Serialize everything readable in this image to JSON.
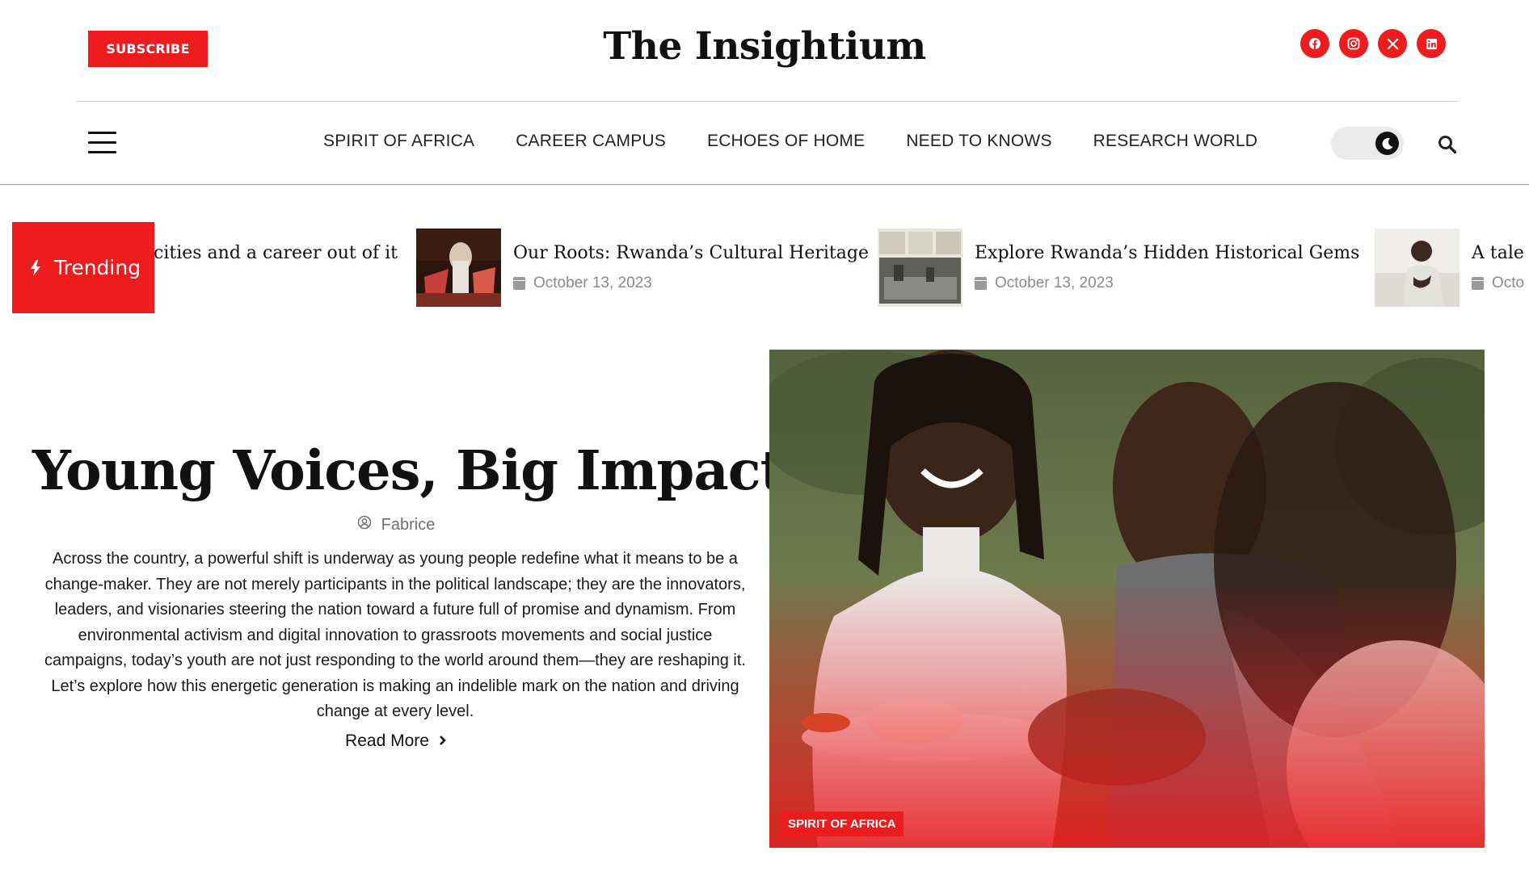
{
  "header": {
    "subscribe_label": "SUBSCRIBE",
    "site_title": "The Insightium",
    "socials": [
      "facebook-icon",
      "instagram-icon",
      "x-icon",
      "linkedin-icon"
    ]
  },
  "nav": {
    "items": [
      "SPIRIT OF AFRICA",
      "CAREER CAMPUS",
      "ECHOES OF HOME",
      "NEED TO KNOWS",
      "RESEARCH WORLD"
    ]
  },
  "trending": {
    "label": "Trending",
    "items": [
      {
        "title": "cities and a career out of it",
        "date": ""
      },
      {
        "title": "Our Roots: Rwanda’s Cultural Heritage",
        "date": "October 13, 2023"
      },
      {
        "title": "Explore Rwanda’s Hidden Historical Gems",
        "date": "October 13, 2023"
      },
      {
        "title": "A tale",
        "date": "Octo"
      }
    ]
  },
  "hero": {
    "title": "Young Voices, Big Impact",
    "author": "Fabrice",
    "excerpt": "Across the country, a powerful shift is underway as young people redefine what it means to be a change-maker. They are not merely participants in the political landscape; they are the innovators, leaders, and visionaries steering the nation toward a future full of promise and dynamism. From environmental activism and digital innovation to grassroots movements and social justice campaigns, today’s youth are not just responding to the world around them—they are reshaping it. Let’s explore how this energetic generation is making an indelible mark on the nation and driving change at every level.",
    "read_more": "Read More",
    "tag": "SPIRIT OF AFRICA"
  },
  "colors": {
    "accent": "#ee1c1f",
    "text": "#111111",
    "muted": "#8a8a8a"
  }
}
